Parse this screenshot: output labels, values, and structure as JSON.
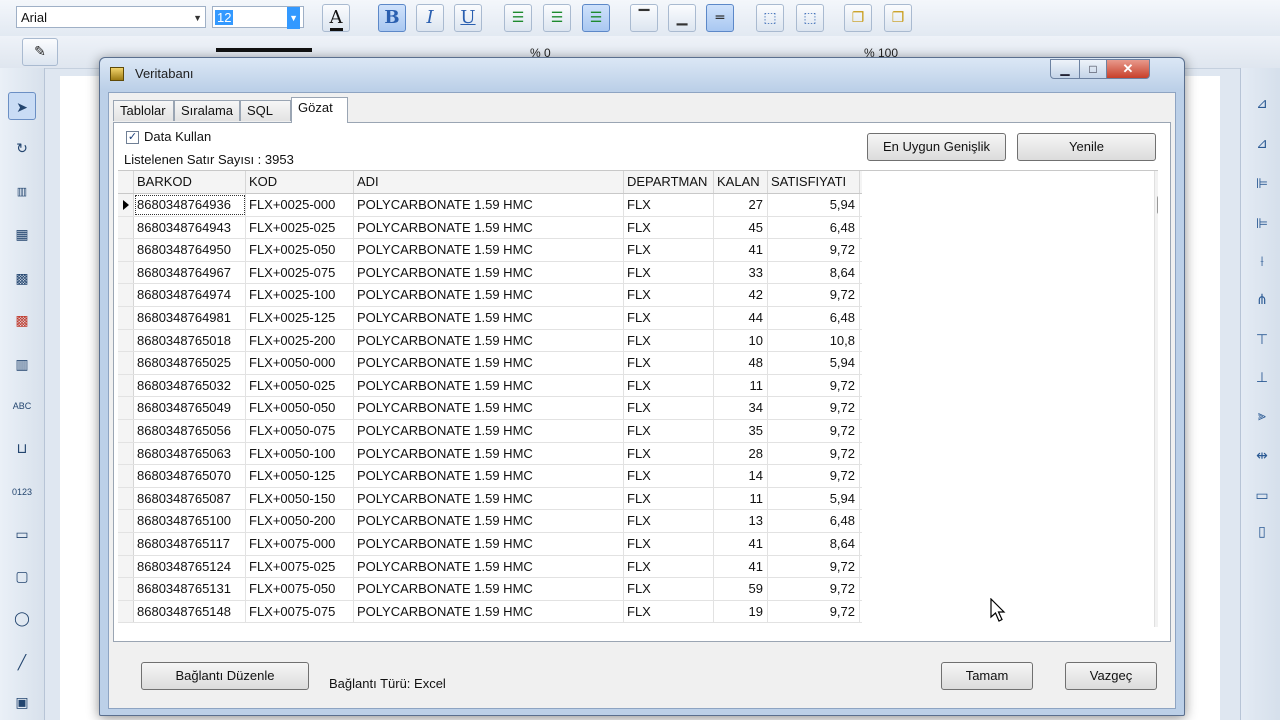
{
  "app": {
    "font_name": "Arial",
    "font_size": "12",
    "toolbar": {
      "bold": "B",
      "italic": "I",
      "underline": "U",
      "font_color": "A",
      "percent1": "% 0",
      "percent2": "% 100"
    }
  },
  "dialog": {
    "title": "Veritabanı",
    "close_glyph": "✕",
    "min_glyph": "▁",
    "max_glyph": "□",
    "tabs": [
      "Tablolar",
      "Sıralama",
      "SQL",
      "Gözat"
    ],
    "active_tab": "Gözat",
    "use_data_label": "Data Kullan",
    "use_data_checked": true,
    "row_count_text": "Listelenen Satır Sayısı : 3953",
    "best_fit_button": "En Uygun Genişlik",
    "refresh_button": "Yenile",
    "columns": [
      "BARKOD",
      "KOD",
      "ADI",
      "DEPARTMAN",
      "KALAN",
      "SATISFIYATI"
    ],
    "rows": [
      [
        "8680348764936",
        "FLX+0025-000",
        "POLYCARBONATE 1.59 HMC",
        "FLX",
        "27",
        "5,94"
      ],
      [
        "8680348764943",
        "FLX+0025-025",
        "POLYCARBONATE 1.59 HMC",
        "FLX",
        "45",
        "6,48"
      ],
      [
        "8680348764950",
        "FLX+0025-050",
        "POLYCARBONATE 1.59 HMC",
        "FLX",
        "41",
        "9,72"
      ],
      [
        "8680348764967",
        "FLX+0025-075",
        "POLYCARBONATE 1.59 HMC",
        "FLX",
        "33",
        "8,64"
      ],
      [
        "8680348764974",
        "FLX+0025-100",
        "POLYCARBONATE 1.59 HMC",
        "FLX",
        "42",
        "9,72"
      ],
      [
        "8680348764981",
        "FLX+0025-125",
        "POLYCARBONATE 1.59 HMC",
        "FLX",
        "44",
        "6,48"
      ],
      [
        "8680348765018",
        "FLX+0025-200",
        "POLYCARBONATE 1.59 HMC",
        "FLX",
        "10",
        "10,8"
      ],
      [
        "8680348765025",
        "FLX+0050-000",
        "POLYCARBONATE 1.59 HMC",
        "FLX",
        "48",
        "5,94"
      ],
      [
        "8680348765032",
        "FLX+0050-025",
        "POLYCARBONATE 1.59 HMC",
        "FLX",
        "11",
        "9,72"
      ],
      [
        "8680348765049",
        "FLX+0050-050",
        "POLYCARBONATE 1.59 HMC",
        "FLX",
        "34",
        "9,72"
      ],
      [
        "8680348765056",
        "FLX+0050-075",
        "POLYCARBONATE 1.59 HMC",
        "FLX",
        "35",
        "9,72"
      ],
      [
        "8680348765063",
        "FLX+0050-100",
        "POLYCARBONATE 1.59 HMC",
        "FLX",
        "28",
        "9,72"
      ],
      [
        "8680348765070",
        "FLX+0050-125",
        "POLYCARBONATE 1.59 HMC",
        "FLX",
        "14",
        "9,72"
      ],
      [
        "8680348765087",
        "FLX+0050-150",
        "POLYCARBONATE 1.59 HMC",
        "FLX",
        "11",
        "5,94"
      ],
      [
        "8680348765100",
        "FLX+0050-200",
        "POLYCARBONATE 1.59 HMC",
        "FLX",
        "13",
        "6,48"
      ],
      [
        "8680348765117",
        "FLX+0075-000",
        "POLYCARBONATE 1.59 HMC",
        "FLX",
        "41",
        "8,64"
      ],
      [
        "8680348765124",
        "FLX+0075-025",
        "POLYCARBONATE 1.59 HMC",
        "FLX",
        "41",
        "9,72"
      ],
      [
        "8680348765131",
        "FLX+0075-050",
        "POLYCARBONATE 1.59 HMC",
        "FLX",
        "59",
        "9,72"
      ],
      [
        "8680348765148",
        "FLX+0075-075",
        "POLYCARBONATE 1.59 HMC",
        "FLX",
        "19",
        "9,72"
      ]
    ],
    "edit_connection_button": "Bağlantı Düzenle",
    "connection_type_text": "Bağlantı Türü: Excel",
    "ok_button": "Tamam",
    "cancel_button": "Vazgeç"
  }
}
